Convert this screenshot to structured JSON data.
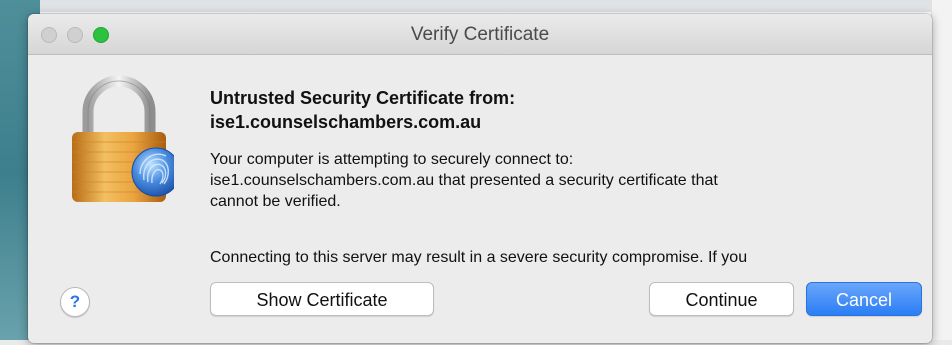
{
  "window": {
    "title": "Verify Certificate"
  },
  "dialog": {
    "headline_line1": "Untrusted Security Certificate from:",
    "headline_line2": "ise1.counselschambers.com.au",
    "body_line1": "Your computer is attempting to securely connect to:",
    "body_line2": "ise1.counselschambers.com.au that presented a security certificate that",
    "body_line3": "cannot be verified.",
    "body_line4": "Connecting to this server may result in a severe security compromise. If you"
  },
  "buttons": {
    "help": "?",
    "show_certificate": "Show Certificate",
    "continue": "Continue",
    "cancel": "Cancel"
  },
  "icons": {
    "lock": "padlock-fingerprint-icon"
  },
  "colors": {
    "accent": "#2a7ef5",
    "zoom_green": "#2cc240",
    "lock_gold": "#e8a640"
  }
}
